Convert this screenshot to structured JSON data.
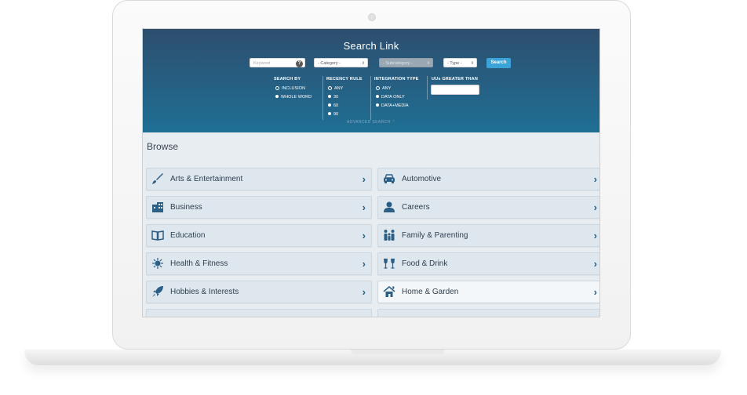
{
  "search": {
    "title": "Search Link",
    "keyword_placeholder": "Keyword",
    "help_icon": "?",
    "category_label": "- Category -",
    "subcategory_label": "- Subcategory -",
    "type_label": "- Type -",
    "search_button": "Search",
    "search_by": {
      "label": "SEARCH BY",
      "options": [
        "INCLUSION",
        "WHOLE WORD"
      ]
    },
    "recency": {
      "label": "RECENCY RULE",
      "options": [
        "ANY",
        "30",
        "60",
        "90"
      ]
    },
    "integration": {
      "label": "INTEGRATION TYPE",
      "options": [
        "ANY",
        "DATA ONLY",
        "DATA+MEDIA"
      ]
    },
    "uus": {
      "label": "UUs GREATER THAN",
      "value": ""
    },
    "advanced": "ADVANCED SEARCH ⌃"
  },
  "browse": {
    "title": "Browse",
    "tiles": [
      {
        "label": "Arts & Entertainment",
        "icon": "paintbrush-icon"
      },
      {
        "label": "Automotive",
        "icon": "car-icon"
      },
      {
        "label": "Business",
        "icon": "building-icon"
      },
      {
        "label": "Careers",
        "icon": "person-icon"
      },
      {
        "label": "Education",
        "icon": "book-icon"
      },
      {
        "label": "Family & Parenting",
        "icon": "family-icon"
      },
      {
        "label": "Health & Fitness",
        "icon": "virus-icon"
      },
      {
        "label": "Food & Drink",
        "icon": "glasses-icon"
      },
      {
        "label": "Hobbies & Interests",
        "icon": "rocket-icon"
      },
      {
        "label": "Home & Garden",
        "icon": "home-icon"
      }
    ]
  },
  "colors": {
    "header_top": "#2d4e6e",
    "header_bottom": "#1f6f95",
    "accent": "#3aa3d8",
    "tile_bg": "#dfe7ee"
  }
}
